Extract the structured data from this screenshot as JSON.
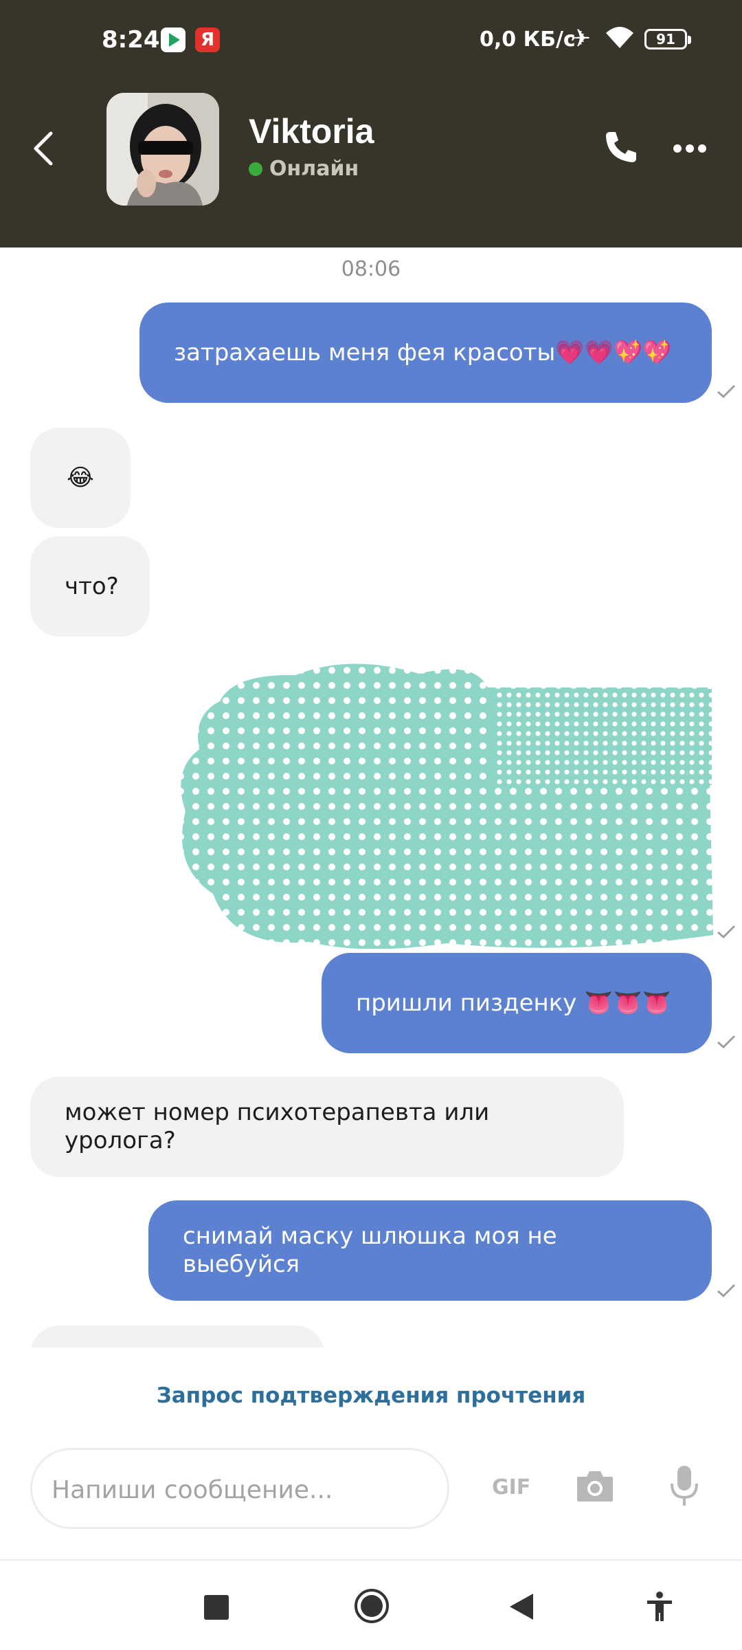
{
  "status_bar": {
    "time": "8:24",
    "network_speed": "0,0 КБ/с",
    "battery": "91",
    "app_icons": [
      "play-store-icon",
      "yandex-icon"
    ],
    "yandex_letter": "Я"
  },
  "header": {
    "contact_name": "Viktoria",
    "status": "Онлайн",
    "status_color": "#3aab3c",
    "background": "#37352a"
  },
  "chat": {
    "date_label": "08:06",
    "messages": [
      {
        "direction": "out",
        "text": "затрахаешь меня фея красоты💗💗💖💖",
        "delivered": true
      },
      {
        "direction": "in",
        "text": "😂"
      },
      {
        "direction": "in",
        "text": "что?"
      },
      {
        "direction": "out",
        "type": "sticker",
        "delivered": true
      },
      {
        "direction": "out",
        "text": "пришли пизденку 👅👅👅",
        "delivered": true
      },
      {
        "direction": "in",
        "text": "может номер психотерапевта или уролога?"
      },
      {
        "direction": "out",
        "text": "снимай маску шлюшка моя не выебуйся",
        "delivered": true
      }
    ],
    "outgoing_color": "#5b81d0",
    "incoming_color": "#f2f2f1"
  },
  "read_request": "Запрос подтверждения прочтения",
  "composer": {
    "placeholder": "Напиши сообщение...",
    "gif_label": "GIF"
  },
  "navigation": [
    "recents-square-icon",
    "home-circle-icon",
    "back-triangle-icon",
    "accessibility-icon"
  ]
}
